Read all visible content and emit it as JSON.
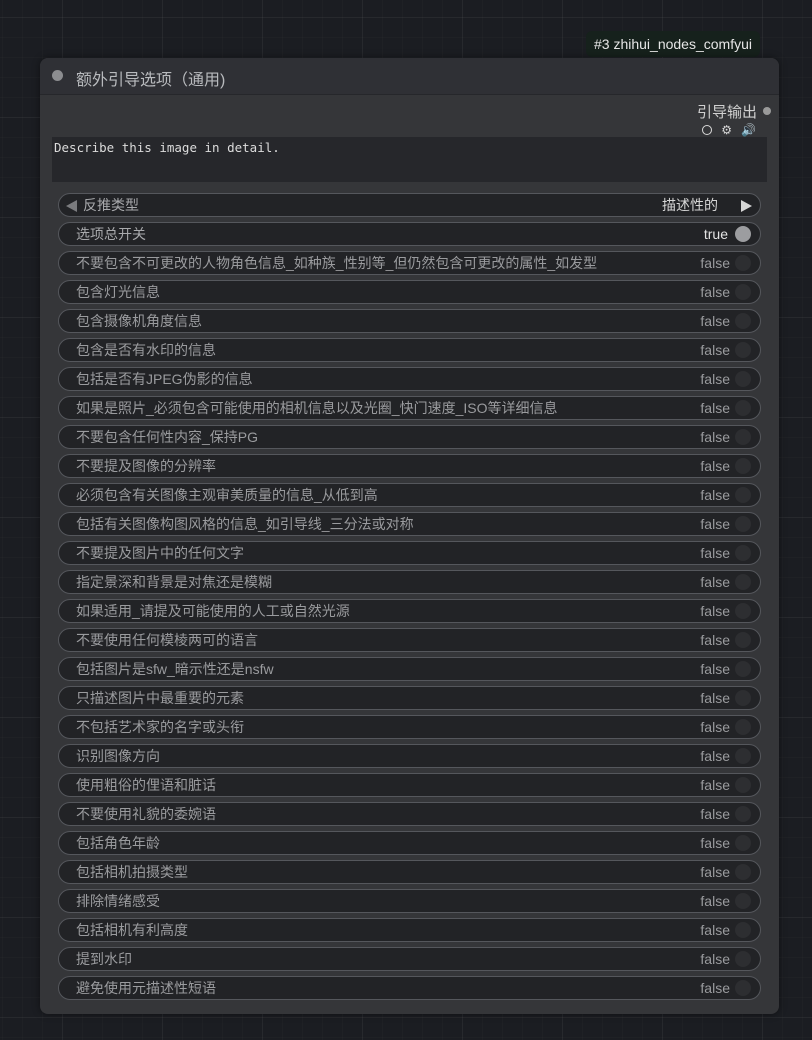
{
  "badge": {
    "text": "#3 zhihui_nodes_comfyui"
  },
  "node": {
    "title": "额外引导选项（通用)",
    "output_label": "引导输出",
    "prompt_text": "Describe this image in detail."
  },
  "combo": {
    "label": "反推类型",
    "value": "描述性的"
  },
  "master_toggle": {
    "label": "选项总开关",
    "value": "true"
  },
  "options": [
    {
      "label": "不要包含不可更改的人物角色信息_如种族_性别等_但仍然包含可更改的属性_如发型",
      "value": "false"
    },
    {
      "label": "包含灯光信息",
      "value": "false"
    },
    {
      "label": "包含摄像机角度信息",
      "value": "false"
    },
    {
      "label": "包含是否有水印的信息",
      "value": "false"
    },
    {
      "label": "包括是否有JPEG伪影的信息",
      "value": "false"
    },
    {
      "label": "如果是照片_必须包含可能使用的相机信息以及光圈_快门速度_ISO等详细信息",
      "value": "false"
    },
    {
      "label": "不要包含任何性内容_保持PG",
      "value": "false"
    },
    {
      "label": "不要提及图像的分辨率",
      "value": "false"
    },
    {
      "label": "必须包含有关图像主观审美质量的信息_从低到高",
      "value": "false"
    },
    {
      "label": "包括有关图像构图风格的信息_如引导线_三分法或对称",
      "value": "false"
    },
    {
      "label": "不要提及图片中的任何文字",
      "value": "false"
    },
    {
      "label": "指定景深和背景是对焦还是模糊",
      "value": "false"
    },
    {
      "label": "如果适用_请提及可能使用的人工或自然光源",
      "value": "false"
    },
    {
      "label": "不要使用任何模棱两可的语言",
      "value": "false"
    },
    {
      "label": "包括图片是sfw_暗示性还是nsfw",
      "value": "false"
    },
    {
      "label": "只描述图片中最重要的元素",
      "value": "false"
    },
    {
      "label": "不包括艺术家的名字或头衔",
      "value": "false"
    },
    {
      "label": "识别图像方向",
      "value": "false"
    },
    {
      "label": "使用粗俗的俚语和脏话",
      "value": "false"
    },
    {
      "label": "不要使用礼貌的委婉语",
      "value": "false"
    },
    {
      "label": "包括角色年龄",
      "value": "false"
    },
    {
      "label": "包括相机拍摄类型",
      "value": "false"
    },
    {
      "label": "排除情绪感受",
      "value": "false"
    },
    {
      "label": "包括相机有利高度",
      "value": "false"
    },
    {
      "label": "提到水印",
      "value": "false"
    },
    {
      "label": "避免使用元描述性短语",
      "value": "false"
    }
  ]
}
